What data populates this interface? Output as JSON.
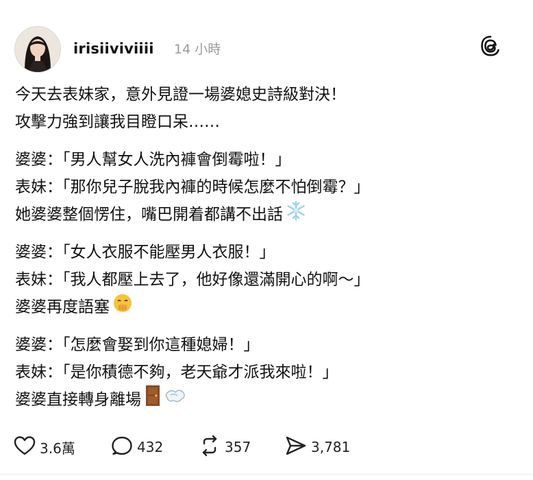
{
  "post": {
    "username": "irisiiviviiii",
    "timestamp": "14 小時",
    "paragraphs": [
      [
        "今天去表妹家，意外見證一場婆媳史詩級對決！",
        "攻擊力強到讓我目瞪口呆……"
      ],
      [
        "婆婆：「男人幫女人洗內褲會倒霉啦！」",
        "表妹：「那你兒子脫我內褲的時候怎麼不怕倒霉？」",
        "她婆婆整個愣住，嘴巴開着都講不出話"
      ],
      [
        "婆婆：「女人衣服不能壓男人衣服！」",
        "表妹：「我人都壓上去了，他好像還滿開心的啊～」",
        "婆婆再度語塞"
      ],
      [
        "婆婆：「怎麼會娶到你這種媳婦！」",
        "表妹：「是你積德不夠，老天爺才派我來啦！」",
        "婆婆直接轉身離場"
      ]
    ],
    "emojis": {
      "p1": "snowflake-emoji",
      "p2": "face-with-hand-over-mouth-emoji",
      "p3a": "door-emoji",
      "p3b": "dashing-away-emoji"
    }
  },
  "actions": {
    "likes": "3.6萬",
    "replies": "432",
    "reposts": "357",
    "shares": "3,781"
  },
  "icons": {
    "threads": "threads-logo-icon",
    "like": "heart-icon",
    "reply": "comment-icon",
    "repost": "repost-icon",
    "share": "send-icon"
  },
  "colors": {
    "text": "#111111",
    "muted": "#9a9a9a",
    "snowflake": "#9fd3ee",
    "emoji_face": "#f6c33a",
    "door": "#8a4a22"
  }
}
